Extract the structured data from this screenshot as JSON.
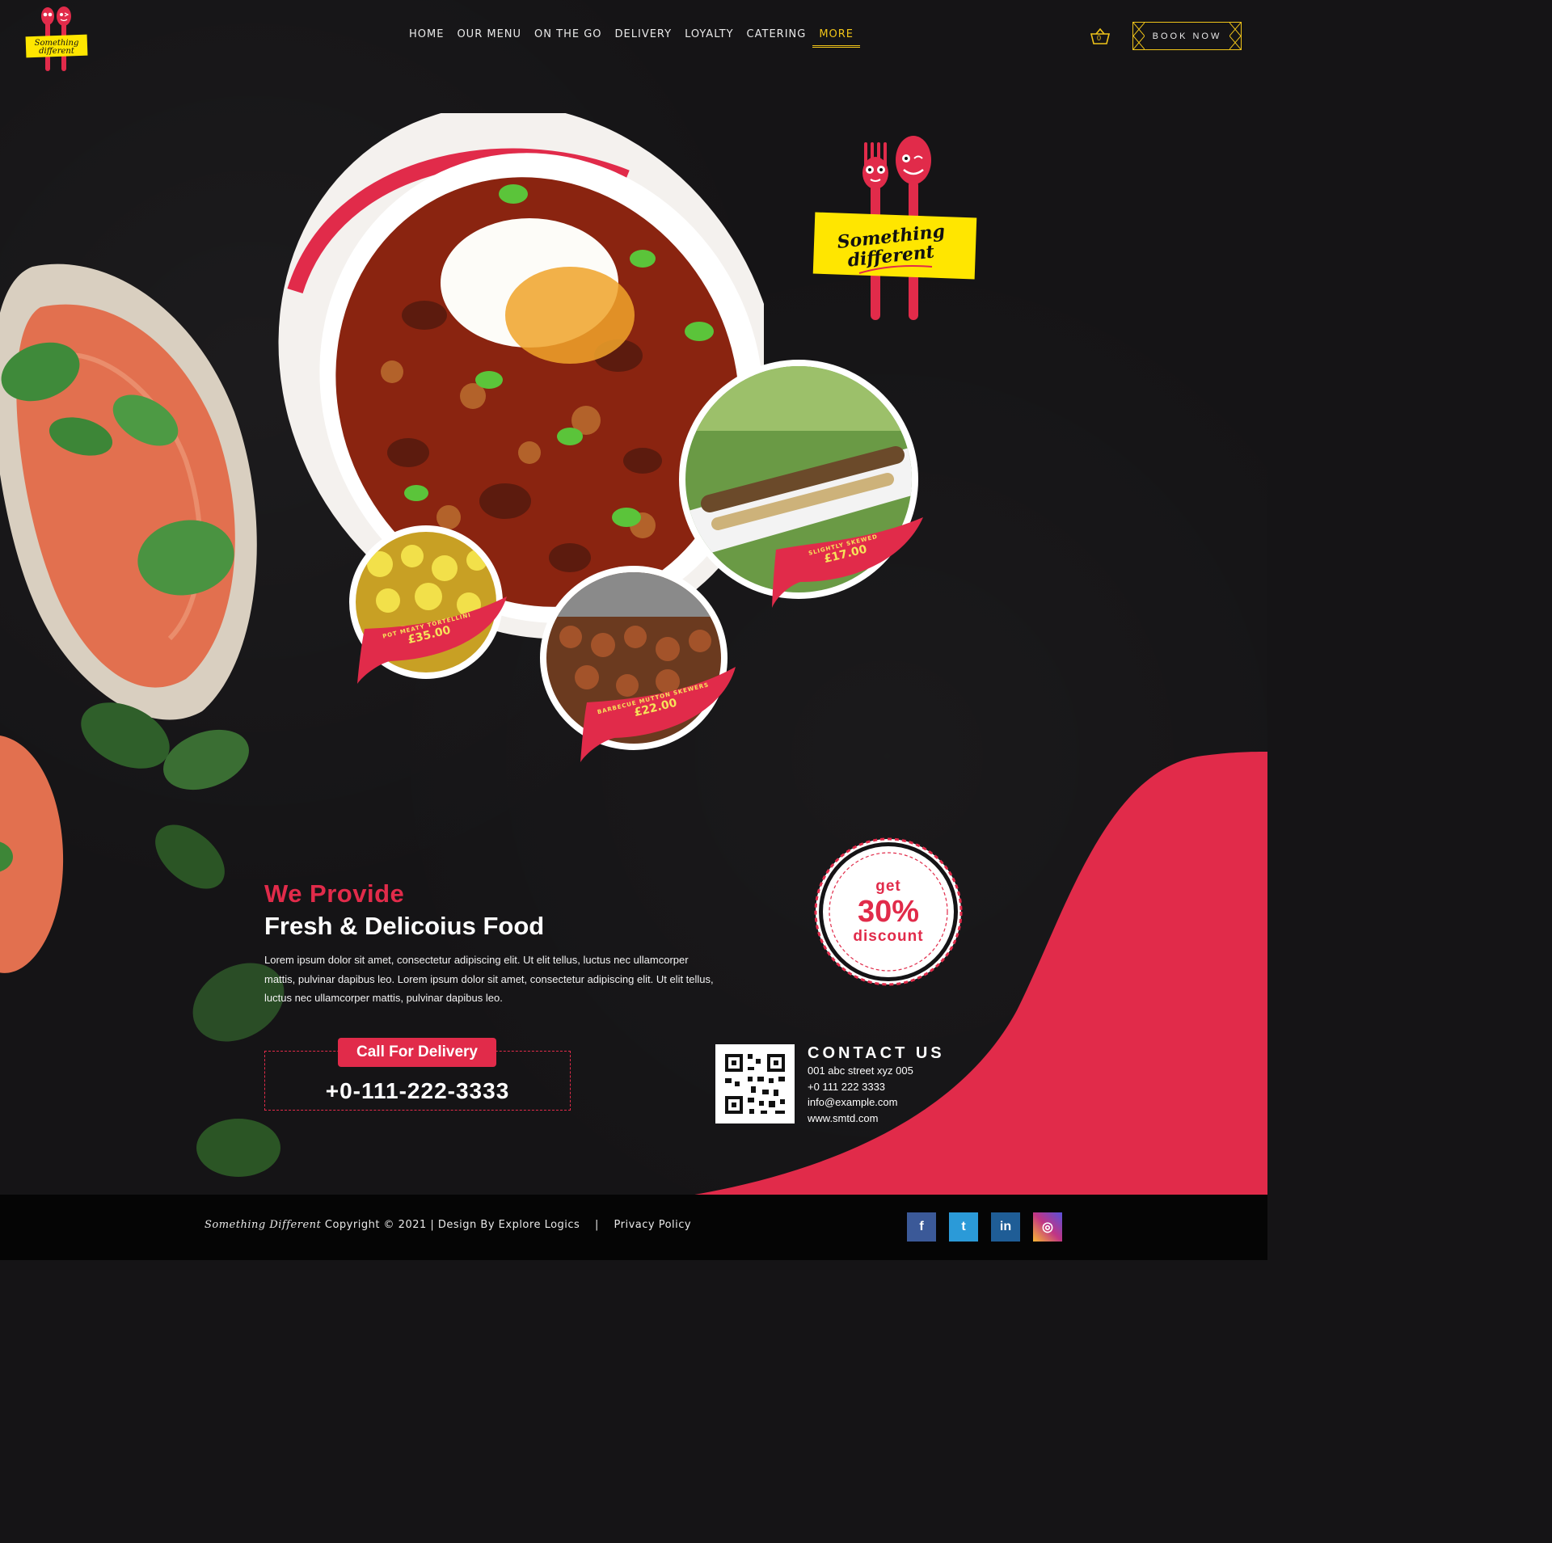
{
  "brand": {
    "logo_line1": "Something",
    "logo_line2": "different"
  },
  "nav": {
    "items": [
      "HOME",
      "OUR MENU",
      "ON THE GO",
      "DELIVERY",
      "LOYALTY",
      "CATERING",
      "MORE"
    ],
    "active": "MORE"
  },
  "header": {
    "cart_count": "0",
    "cart_icon": "basket-icon",
    "book_label": "BOOK NOW"
  },
  "dishes": [
    {
      "name": "POT MEATY TORTELLINI",
      "price": "£35.00"
    },
    {
      "name": "BARBECUE MUTTON SKEWERS",
      "price": "£22.00"
    },
    {
      "name": "SLIGHTLY SKEWED",
      "price": "£17.00"
    }
  ],
  "provide": {
    "tagline": "We Provide",
    "headline": "Fresh & Delicoius Food",
    "body": "Lorem ipsum dolor sit amet, consectetur adipiscing elit. Ut elit tellus, luctus nec ullamcorper mattis, pulvinar dapibus leo. Lorem ipsum dolor sit amet, consectetur adipiscing elit. Ut elit tellus, luctus nec ullamcorper mattis, pulvinar dapibus leo."
  },
  "delivery": {
    "label": "Call For Delivery",
    "phone": "+0-111-222-3333"
  },
  "discount": {
    "line1": "get",
    "line2": "30%",
    "line3": "discount"
  },
  "contact": {
    "title": "CONTACT US",
    "address": "001 abc street xyz 005",
    "phone": "+0 111 222 3333",
    "email": "info@example.com",
    "website": "www.smtd.com"
  },
  "footer": {
    "brand": "Something Different",
    "copyright": "Copyright © 2021 | Design By Explore Logics",
    "separator": "|",
    "privacy": "Privacy Policy",
    "social": [
      {
        "name": "facebook-icon",
        "glyph": "f",
        "color": "#3b5998"
      },
      {
        "name": "twitter-icon",
        "glyph": "t",
        "color": "#2b9ad8"
      },
      {
        "name": "linkedin-icon",
        "glyph": "in",
        "color": "#1f5d96"
      },
      {
        "name": "instagram-icon",
        "glyph": "◎",
        "color": "#c13584"
      }
    ]
  },
  "colors": {
    "accent": "#e12b4a",
    "gold": "#f0c419",
    "background": "#151416",
    "logo_yellow": "#ffe600"
  }
}
